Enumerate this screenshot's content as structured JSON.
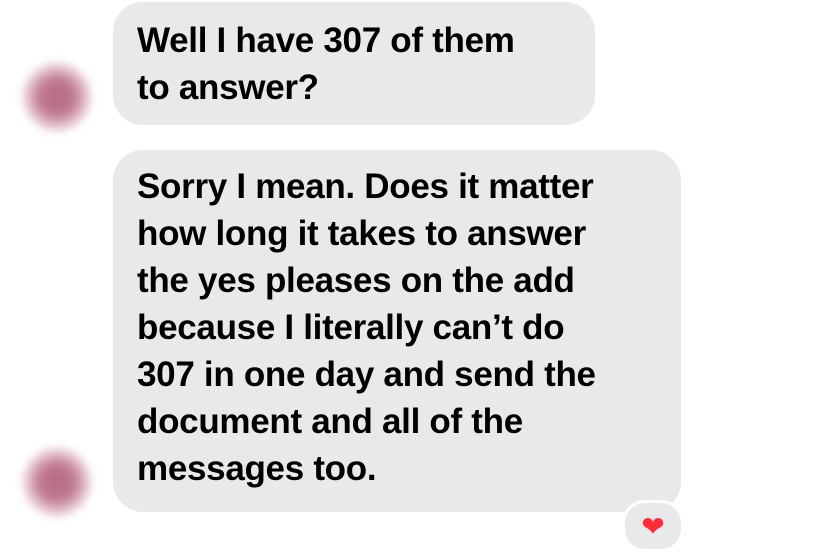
{
  "messages": [
    {
      "lines": [
        "Well I have 307 of them",
        "to answer?"
      ]
    },
    {
      "lines": [
        "Sorry I mean. Does it matter",
        "how long it takes to answer",
        "the yes pleases on the add",
        "because I literally can’t do",
        "307 in one day and send the",
        "document and all of the",
        "messages too."
      ],
      "reaction": "❤"
    }
  ],
  "colors": {
    "bubble": "#e9e9eb",
    "reaction_heart": "#ff2d3a"
  }
}
